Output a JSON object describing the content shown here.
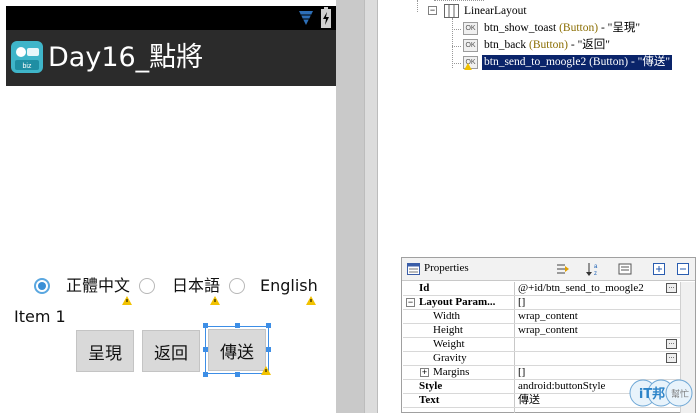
{
  "preview": {
    "app_title": "Day16_點將",
    "radios": [
      {
        "label": "正體中文",
        "checked": true
      },
      {
        "label": "日本語",
        "checked": false
      },
      {
        "label": "English",
        "checked": false
      }
    ],
    "item_text": "Item 1",
    "buttons": [
      "呈現",
      "返回",
      "傳送"
    ]
  },
  "outline": {
    "root": "LinearLayout",
    "children": [
      {
        "id": "btn_show_toast",
        "type": "(Button)",
        "text": "- \"呈現\""
      },
      {
        "id": "btn_back",
        "type": "(Button)",
        "text": "- \"返回\""
      },
      {
        "id": "btn_send_to_moogle2",
        "type": "(Button)",
        "text": "- \"傳送\"",
        "selected": true
      }
    ]
  },
  "properties": {
    "title": "Properties",
    "rows": [
      {
        "name": "Id",
        "value": "@+id/btn_send_to_moogle2",
        "bold": true,
        "indent": 0,
        "expander": "",
        "ellipsis": true
      },
      {
        "name": "Layout Param...",
        "value": "[]",
        "bold": true,
        "indent": 0,
        "expander": "-",
        "ellipsis": false
      },
      {
        "name": "Width",
        "value": "wrap_content",
        "bold": false,
        "indent": 1,
        "expander": "",
        "ellipsis": false
      },
      {
        "name": "Height",
        "value": "wrap_content",
        "bold": false,
        "indent": 1,
        "expander": "",
        "ellipsis": false
      },
      {
        "name": "Weight",
        "value": "",
        "bold": false,
        "indent": 1,
        "expander": "",
        "ellipsis": true
      },
      {
        "name": "Gravity",
        "value": "",
        "bold": false,
        "indent": 1,
        "expander": "",
        "ellipsis": true
      },
      {
        "name": "Margins",
        "value": "[]",
        "bold": false,
        "indent": 1,
        "expander": "+",
        "ellipsis": false
      },
      {
        "name": "Style",
        "value": "android:buttonStyle",
        "bold": true,
        "indent": 0,
        "expander": "",
        "ellipsis": true
      },
      {
        "name": "Text",
        "value": "傳送",
        "bold": true,
        "indent": 0,
        "expander": "",
        "ellipsis": true
      }
    ]
  },
  "watermark": {
    "line1": "iT邦",
    "line2": "幫忙"
  },
  "colors": {
    "selection_highlight": "#0a246a",
    "accent_blue": "#3d8ee6",
    "actionbar": "#2b2b2b"
  }
}
